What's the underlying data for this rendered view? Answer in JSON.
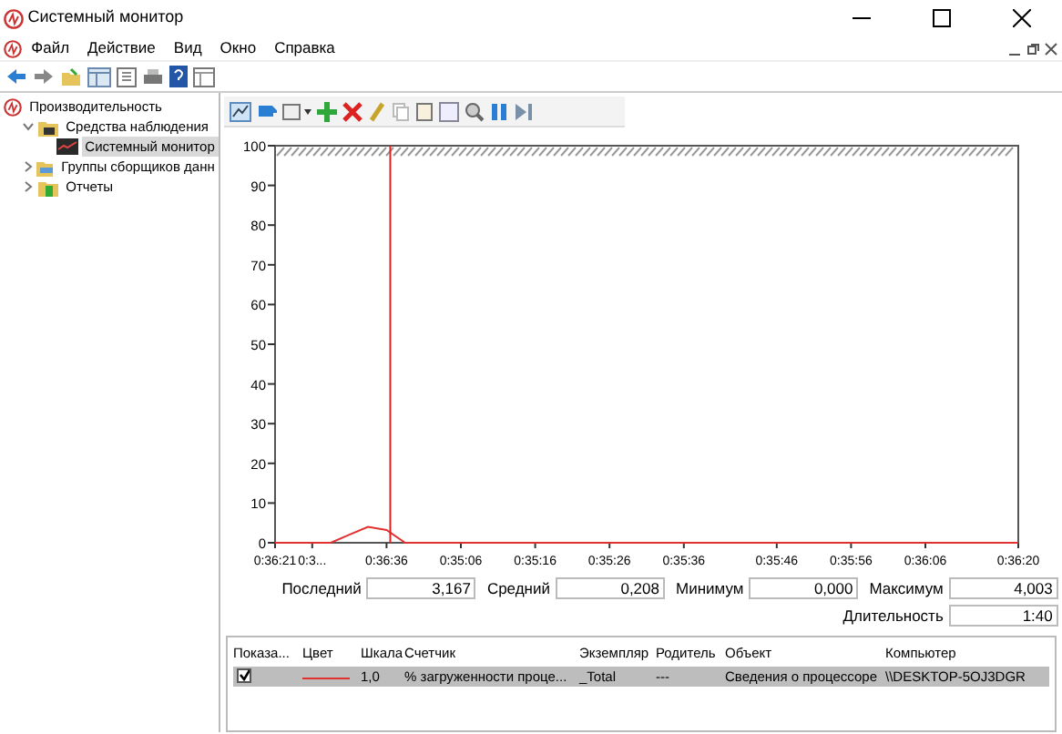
{
  "window": {
    "title": "Системный монитор"
  },
  "menu": [
    "Файл",
    "Действие",
    "Вид",
    "Окно",
    "Справка"
  ],
  "tree": [
    {
      "label": "Производительность",
      "kind": "root",
      "selected": false,
      "children": [
        {
          "label": "Средства наблюдения",
          "kind": "folder",
          "expanded": true,
          "selected": false,
          "children": [
            {
              "label": "Системный монитор",
              "kind": "monitor",
              "selected": true
            }
          ]
        },
        {
          "label": "Группы сборщиков данн",
          "kind": "groups",
          "expanded": false,
          "selected": false
        },
        {
          "label": "Отчеты",
          "kind": "reports",
          "expanded": false,
          "selected": false
        }
      ]
    }
  ],
  "chart_data": {
    "type": "line",
    "ylim": [
      0,
      100
    ],
    "yticks": [
      0,
      10,
      20,
      30,
      40,
      50,
      60,
      70,
      80,
      90,
      100
    ],
    "categories": [
      "0:36:21",
      null,
      "0:3...",
      null,
      null,
      null,
      "0:36:36",
      null,
      null,
      null,
      "0:35:06",
      null,
      null,
      null,
      "0:35:16",
      null,
      null,
      null,
      "0:35:26",
      null,
      null,
      null,
      "0:35:36",
      null,
      null,
      null,
      null,
      "0:35:46",
      null,
      null,
      null,
      "0:35:56",
      null,
      null,
      null,
      "0:36:06",
      null,
      null,
      null,
      null,
      "0:36:20"
    ],
    "series": [
      {
        "color": "#e03030",
        "values": [
          0,
          0,
          0,
          0,
          2,
          4,
          3.2,
          0,
          0,
          0,
          0,
          0,
          0,
          0,
          0,
          0,
          0,
          0,
          0,
          0,
          0,
          0,
          0,
          0,
          0,
          0,
          0,
          0,
          0,
          0,
          0,
          0,
          0,
          0,
          0,
          0,
          0,
          0,
          0,
          0,
          0
        ]
      }
    ]
  },
  "stats": [
    {
      "label": "Последний",
      "value": "3,167"
    },
    {
      "label": "Средний",
      "value": "0,208"
    },
    {
      "label": "Минимум",
      "value": "0,000"
    },
    {
      "label": "Максимум",
      "value": "4,003"
    },
    {
      "label": "Длительность",
      "value": "1:40"
    }
  ],
  "legend": {
    "columns": [
      "Показа...",
      "Цвет",
      "Шкала",
      "Счетчик",
      "Экземпляр",
      "Родитель",
      "Объект",
      "Компьютер"
    ],
    "rows": [
      {
        "shown": true,
        "color": "#e03030",
        "selected": true,
        "cells": [
          "",
          "",
          "1,0",
          "% загруженности проце...",
          "_Total",
          "---",
          "Сведения о процессоре",
          "\\\\DESKTOP-5OJ3DGR"
        ]
      }
    ]
  }
}
